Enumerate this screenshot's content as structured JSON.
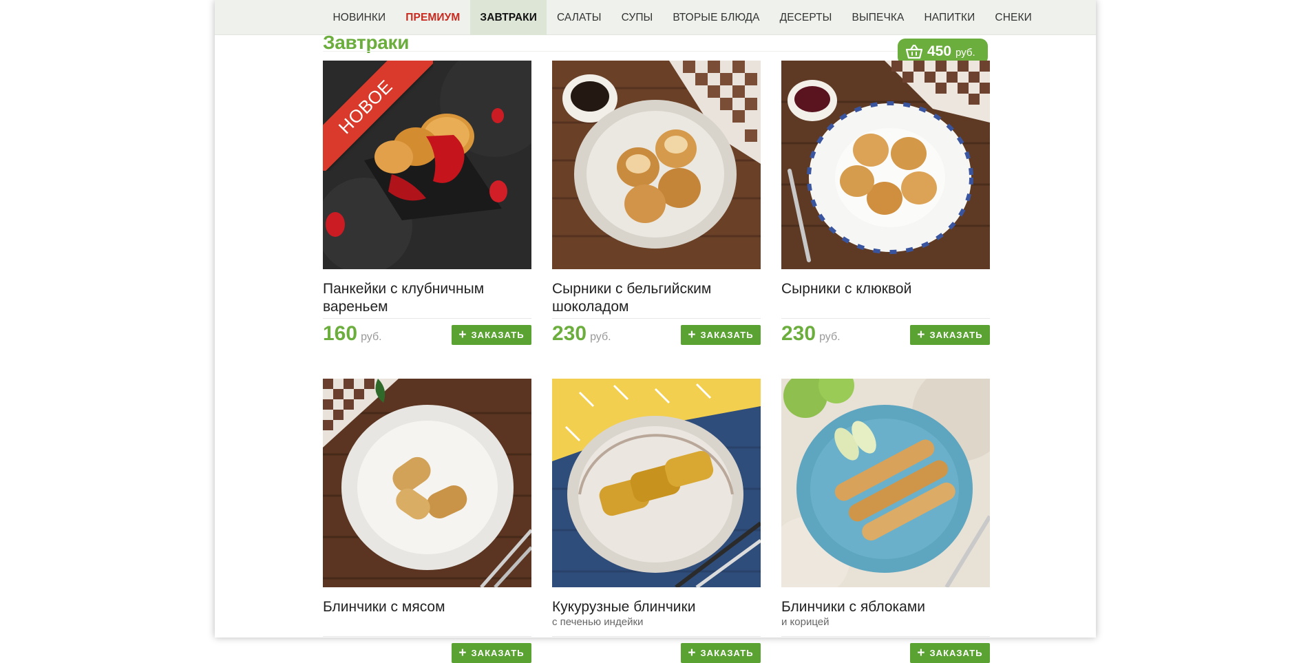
{
  "nav": {
    "items": [
      {
        "label": "НОВИНКИ"
      },
      {
        "label": "ПРЕМИУМ"
      },
      {
        "label": "ЗАВТРАКИ"
      },
      {
        "label": "САЛАТЫ"
      },
      {
        "label": "СУПЫ"
      },
      {
        "label": "ВТОРЫЕ БЛЮДА"
      },
      {
        "label": "ДЕСЕРТЫ"
      },
      {
        "label": "ВЫПЕЧКА"
      },
      {
        "label": "НАПИТКИ"
      },
      {
        "label": "СНЕКИ"
      }
    ],
    "active_label": "ЗАВТРАКИ",
    "premium_label": "ПРЕМИУМ"
  },
  "section": {
    "title": "Завтраки"
  },
  "cart": {
    "amount": "450",
    "currency": "руб.",
    "icon": "basket-icon"
  },
  "order_label": "ЗАКАЗАТЬ",
  "products": [
    {
      "name": "Панкейки с клубничным вареньем",
      "price": "160",
      "currency": "руб.",
      "badge": "НОВОЕ"
    },
    {
      "name": "Сырники с бельгийским шоколадом",
      "price": "230",
      "currency": "руб."
    },
    {
      "name": "Сырники с клюквой",
      "price": "230",
      "currency": "руб."
    },
    {
      "name": "Блинчики с мясом"
    },
    {
      "name": "Кукурузные блинчики",
      "subtitle": "с печенью индейки"
    },
    {
      "name": "Блинчики с яблоками",
      "subtitle": "и корицей"
    }
  ],
  "colors": {
    "brand_green": "#6cae3e",
    "button_green": "#5aa232",
    "premium_red": "#c92a1f",
    "ribbon_red": "#d93a2b",
    "nav_bg": "#eef1ec",
    "nav_active_bg": "#dde5d7"
  }
}
